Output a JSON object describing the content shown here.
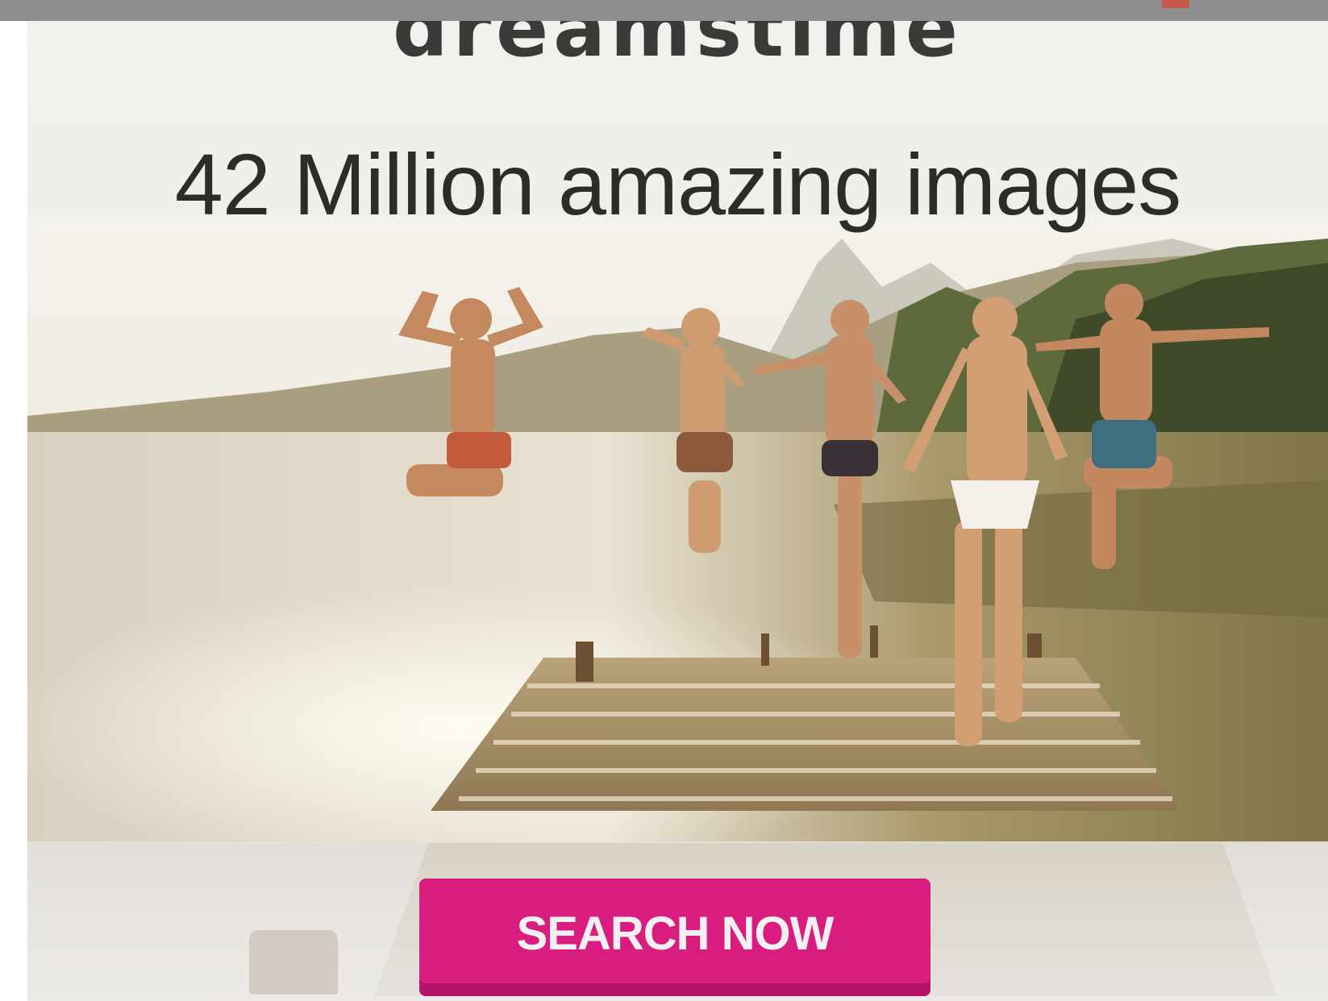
{
  "ad": {
    "brand": "dreamstime",
    "headline": "42 Million amazing images",
    "cta_label": "SEARCH NOW"
  },
  "colors": {
    "cta_background": "#d81d7f",
    "cta_shadow": "#b5136a",
    "cta_text": "#f4f0f2",
    "headline_text": "#2c2c2a",
    "browser_bar": "#8e8e8e"
  }
}
